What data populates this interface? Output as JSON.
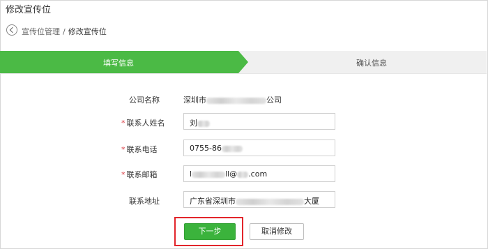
{
  "page": {
    "title": "修改宣传位"
  },
  "breadcrumb": {
    "parent": "宣传位管理",
    "separator": "/",
    "current": "修改宣传位"
  },
  "steps": [
    {
      "label": "填写信息",
      "active": true
    },
    {
      "label": "确认信息",
      "active": false
    }
  ],
  "form": {
    "company": {
      "label": "公司名称",
      "value_prefix": "深圳市",
      "value_suffix": "公司"
    },
    "contact_name": {
      "required_mark": "*",
      "label": "联系人姓名",
      "value": "刘"
    },
    "contact_phone": {
      "required_mark": "*",
      "label": "联系电话",
      "value": "0755-86"
    },
    "contact_email": {
      "required_mark": "*",
      "label": "联系邮箱",
      "value_start": "l",
      "value_middle": "ll@",
      "value_end": ".com"
    },
    "contact_address": {
      "label": "联系地址",
      "value_prefix": "广东省深圳市",
      "value_suffix": "大厦"
    }
  },
  "actions": {
    "next": "下一步",
    "cancel": "取消修改"
  },
  "colors": {
    "accent": "#4bba45",
    "required": "#d9363e",
    "highlight": "#e2252b"
  }
}
